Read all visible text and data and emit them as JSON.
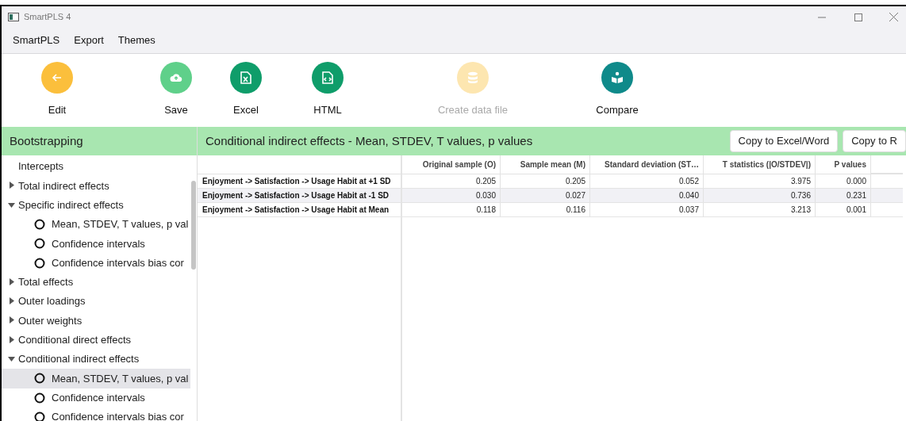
{
  "window": {
    "title": "SmartPLS 4"
  },
  "menu": [
    "SmartPLS",
    "Export",
    "Themes"
  ],
  "toolbar": [
    {
      "label": "Edit",
      "kind": "arrow",
      "color": "#fbbf3c",
      "disabled": false
    },
    {
      "label": "Save",
      "kind": "cloud",
      "color": "#5fd08a",
      "disabled": false
    },
    {
      "label": "Excel",
      "kind": "excel",
      "color": "#0f9d6a",
      "disabled": false
    },
    {
      "label": "HTML",
      "kind": "html",
      "color": "#0f9d6a",
      "disabled": false
    },
    {
      "label": "Create data file",
      "kind": "database",
      "color": "#fde6b0",
      "disabled": true
    },
    {
      "label": "Compare",
      "kind": "book",
      "color": "#0f8a8a",
      "disabled": false
    }
  ],
  "sidebar": {
    "title": "Bootstrapping",
    "items": [
      {
        "label": "Intercepts",
        "kind": "plain"
      },
      {
        "label": "Total indirect effects",
        "kind": "group",
        "expanded": false
      },
      {
        "label": "Specific indirect effects",
        "kind": "group",
        "expanded": true,
        "children": [
          {
            "label": "Mean, STDEV, T values, p val",
            "kind": "leaf",
            "selected": false
          },
          {
            "label": "Confidence intervals",
            "kind": "leaf",
            "selected": false
          },
          {
            "label": "Confidence intervals bias cor",
            "kind": "leaf",
            "selected": false
          }
        ]
      },
      {
        "label": "Total effects",
        "kind": "group",
        "expanded": false
      },
      {
        "label": "Outer loadings",
        "kind": "group",
        "expanded": false
      },
      {
        "label": "Outer weights",
        "kind": "group",
        "expanded": false
      },
      {
        "label": "Conditional direct effects",
        "kind": "group",
        "expanded": false
      },
      {
        "label": "Conditional indirect effects",
        "kind": "group",
        "expanded": true,
        "children": [
          {
            "label": "Mean, STDEV, T values, p val",
            "kind": "leaf",
            "selected": true
          },
          {
            "label": "Confidence intervals",
            "kind": "leaf",
            "selected": false
          },
          {
            "label": "Confidence intervals bias cor",
            "kind": "leaf",
            "selected": false
          }
        ]
      }
    ]
  },
  "panel": {
    "title": "Conditional indirect effects - Mean, STDEV, T values, p values",
    "buttons": [
      "Copy to Excel/Word",
      "Copy to R"
    ]
  },
  "table": {
    "columns": [
      "Original sample (O)",
      "Sample mean (M)",
      "Standard deviation (ST…",
      "T statistics (|O/STDEV|)",
      "P values"
    ],
    "rows": [
      {
        "label": "Enjoyment -> Satisfaction -> Usage Habit at +1 SD",
        "cells": [
          "0.205",
          "0.205",
          "0.052",
          "3.975",
          "0.000"
        ]
      },
      {
        "label": "Enjoyment -> Satisfaction -> Usage Habit at -1 SD",
        "cells": [
          "0.030",
          "0.027",
          "0.040",
          "0.736",
          "0.231"
        ]
      },
      {
        "label": "Enjoyment -> Satisfaction -> Usage Habit at Mean",
        "cells": [
          "0.118",
          "0.116",
          "0.037",
          "3.213",
          "0.001"
        ]
      }
    ]
  }
}
